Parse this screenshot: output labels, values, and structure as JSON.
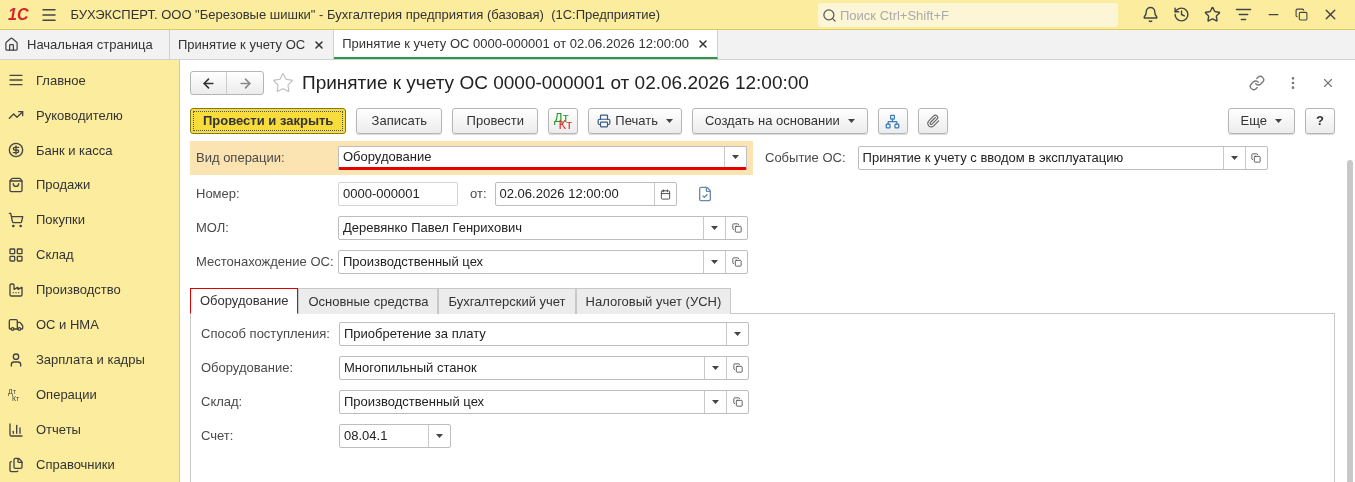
{
  "app_bar": {
    "title": "БУХЭКСПЕРТ. ООО \"Березовые шишки\" - Бухгалтерия предприятия (базовая)  (1С:Предприятие)",
    "logo": "1С",
    "search": {
      "placeholder": "Поиск Ctrl+Shift+F"
    }
  },
  "open_tabs": [
    {
      "label": "Начальная страница",
      "kind": "home",
      "selected": false
    },
    {
      "label": "Принятие к учету ОС",
      "kind": "doc",
      "selected": false
    },
    {
      "label": "Принятие к учету ОС 0000-000001 от 02.06.2026 12:00:00",
      "kind": "doc",
      "selected": true
    }
  ],
  "sidebar": {
    "items": [
      {
        "label": "Главное"
      },
      {
        "label": "Руководителю"
      },
      {
        "label": "Банк и касса"
      },
      {
        "label": "Продажи"
      },
      {
        "label": "Покупки"
      },
      {
        "label": "Склад"
      },
      {
        "label": "Производство"
      },
      {
        "label": "ОС и НМА"
      },
      {
        "label": "Зарплата и кадры"
      },
      {
        "label": "Операции",
        "icon_text": [
          "Дт",
          "Кт"
        ]
      },
      {
        "label": "Отчеты"
      },
      {
        "label": "Справочники"
      }
    ]
  },
  "form": {
    "title": "Принятие к учету ОС 0000-000001 от 02.06.2026 12:00:00",
    "toolbar": [
      {
        "kind": "primary",
        "label": "Провести и закрыть"
      },
      {
        "kind": "button",
        "label": "Записать"
      },
      {
        "kind": "button",
        "label": "Провести"
      },
      {
        "kind": "dtkt",
        "top": "Дт",
        "bottom": "Кт"
      },
      {
        "kind": "print",
        "label": "Печать"
      },
      {
        "kind": "menu",
        "label": "Создать на основании"
      },
      {
        "kind": "structure"
      },
      {
        "kind": "attach"
      }
    ],
    "toolbar_right": [
      {
        "kind": "menu",
        "label": "Еще"
      },
      {
        "kind": "button",
        "label": "?"
      }
    ],
    "operation": {
      "label": "Вид операции:",
      "value": "Оборудование",
      "marked": true
    },
    "event": {
      "label": "Событие ОС:",
      "value": "Принятие к учету с вводом в эксплуатацию"
    },
    "number": {
      "label": "Номер:",
      "value": "0000-000001",
      "date_label": "от:",
      "date": "02.06.2026 12:00:00"
    },
    "fields": [
      {
        "label": "МОЛ:",
        "value": "Деревянко Павел Генрихович",
        "kind": "ref"
      },
      {
        "label": "Местонахождение ОС:",
        "value": "Производственный цех",
        "kind": "ref"
      }
    ],
    "tabs": [
      {
        "label": "Оборудование",
        "selected": true,
        "marked": true
      },
      {
        "label": "Основные средства",
        "selected": false,
        "marked": false
      },
      {
        "label": "Бухгалтерский учет",
        "selected": false,
        "marked": false
      },
      {
        "label": "Налоговый учет (УСН)",
        "selected": false,
        "marked": false
      }
    ],
    "tab_fields": [
      {
        "label": "Способ поступления:",
        "value": "Приобретение за плату",
        "kind": "select"
      },
      {
        "label": "Оборудование:",
        "value": "Многопильный станок",
        "kind": "ref"
      },
      {
        "label": "Склад:",
        "value": "Производственный цех",
        "kind": "ref"
      },
      {
        "label": "Счет:",
        "value": "08.04.1",
        "kind": "short"
      }
    ]
  }
}
